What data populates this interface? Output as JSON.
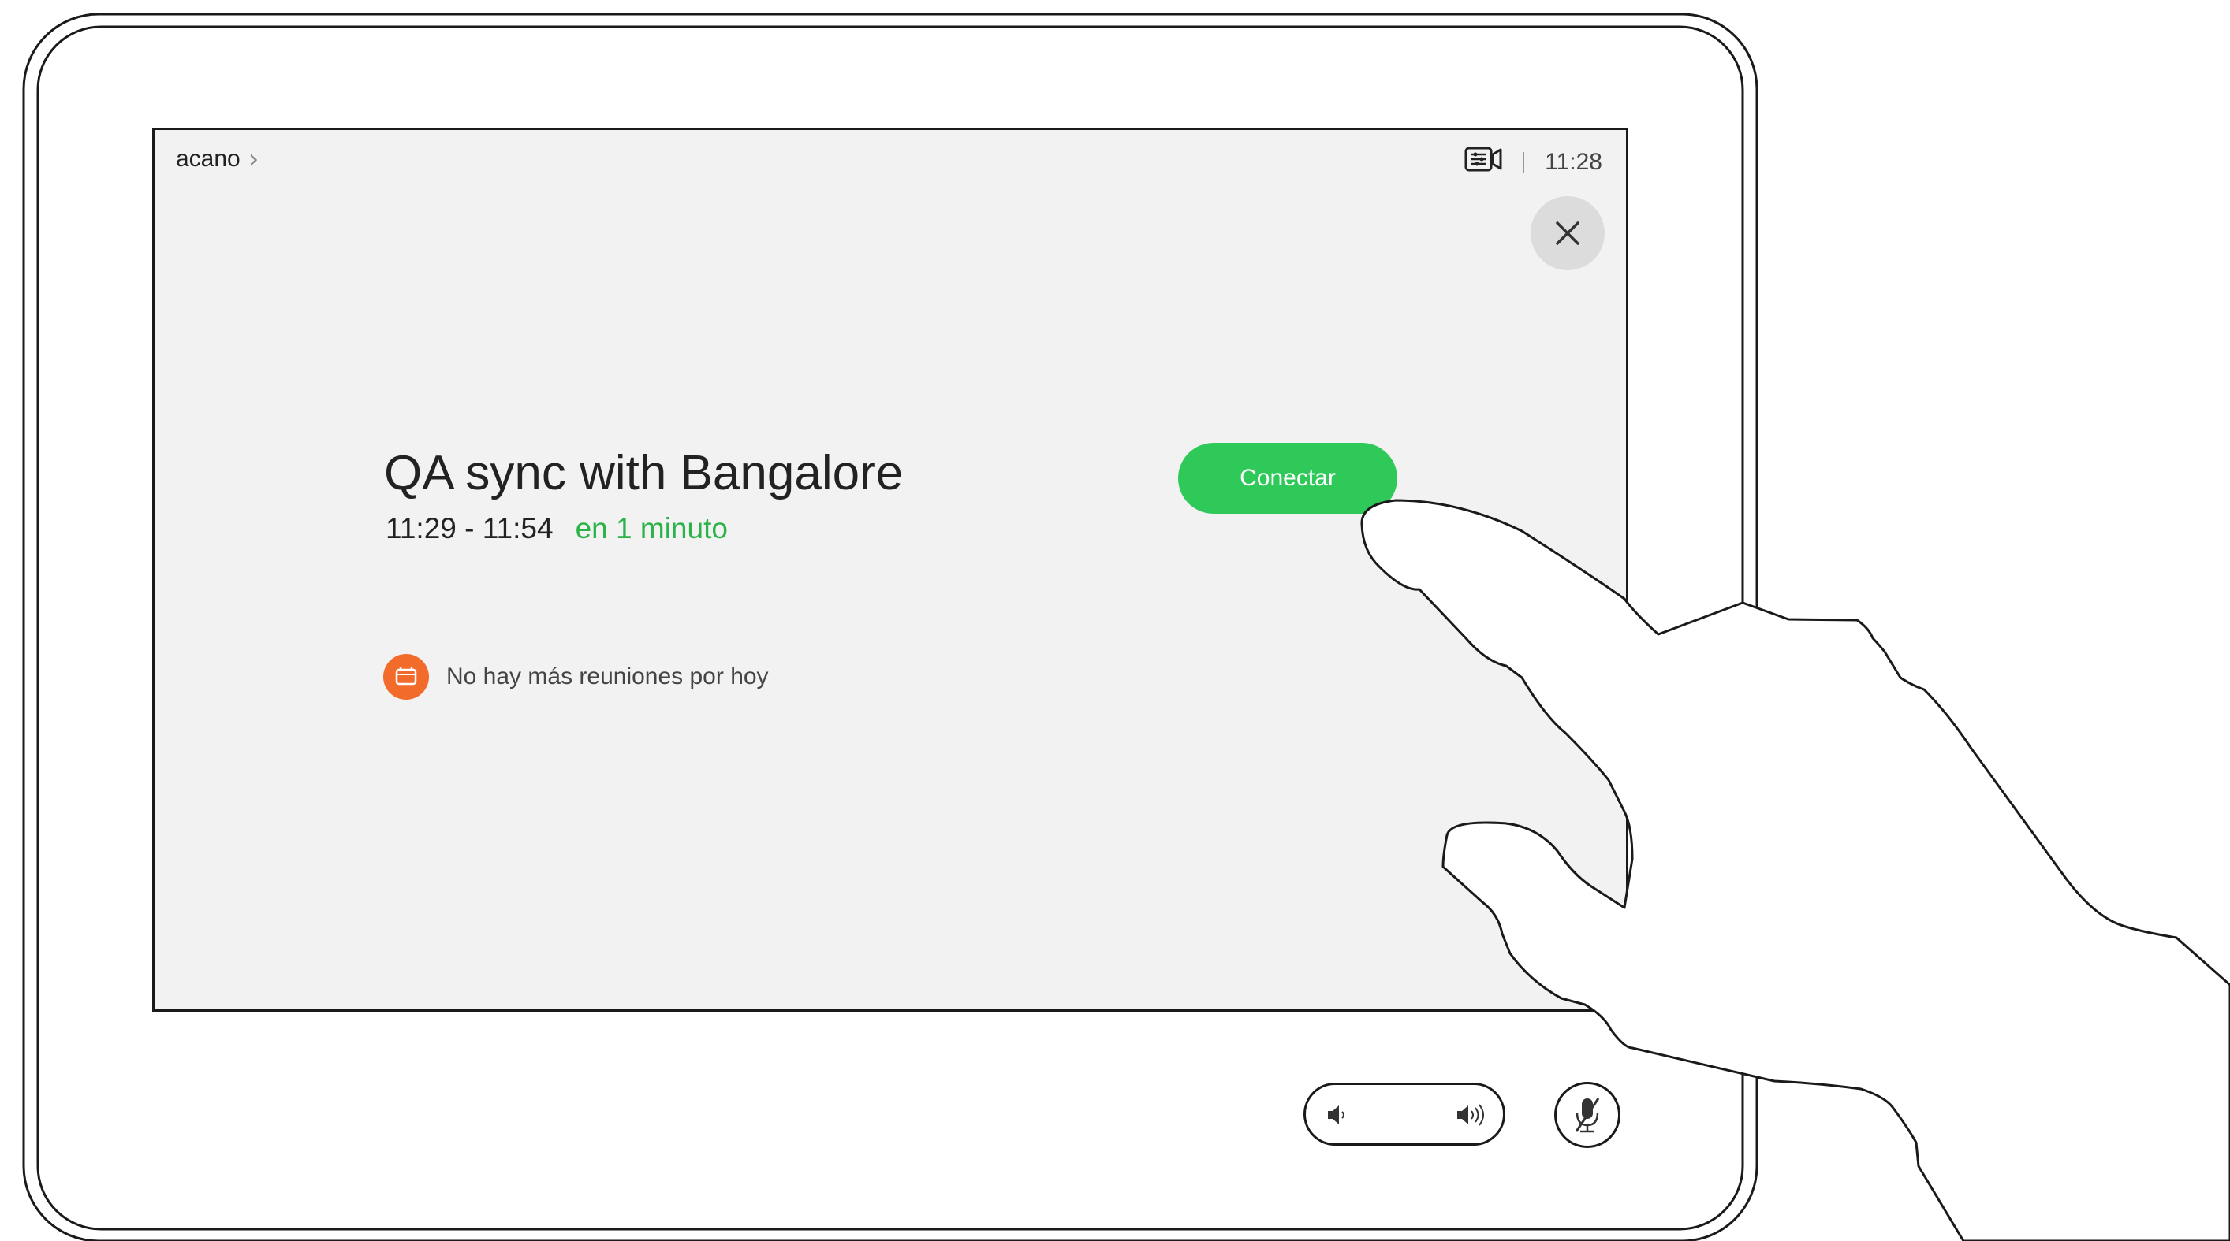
{
  "header": {
    "device_name": "acano",
    "clock": "11:28",
    "status_icon": "camera-settings-icon",
    "close_icon": "close-icon"
  },
  "meeting": {
    "title": "QA sync with Bangalore",
    "time_range": "11:29 - 11:54",
    "relative_time": "en 1 minuto",
    "connect_label": "Conectar"
  },
  "info": {
    "icon": "calendar-icon",
    "text": "No hay más reuniones por hoy"
  },
  "controls": {
    "volume_down_icon": "volume-down-icon",
    "volume_up_icon": "volume-up-icon",
    "mute_icon": "microphone-muted-icon"
  },
  "colors": {
    "screen_bg": "#f2f2f2",
    "connect_green": "#2fc95a",
    "relative_time_green": "#2bb34a",
    "calendar_orange": "#f26b2a",
    "close_button_bg": "#dcdcdc"
  }
}
